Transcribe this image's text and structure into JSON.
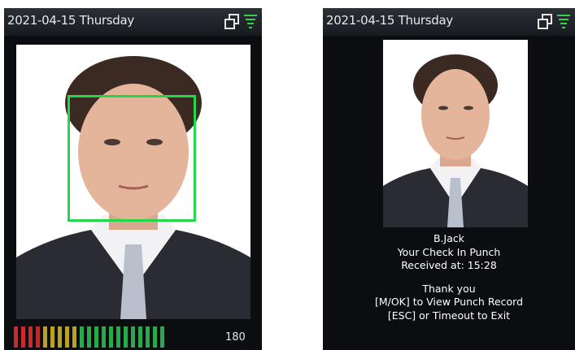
{
  "left_screen": {
    "status": {
      "date_text": "2021-04-15 Thursday",
      "icons": [
        "multi-window-icon",
        "wifi-icon"
      ]
    },
    "face_quality": {
      "value_text": "180",
      "segments": [
        "#cc2a2a",
        "#cc2a2a",
        "#cc2a2a",
        "#b32d2d",
        "#b8a21f",
        "#b8a21f",
        "#b8a21f",
        "#b8a21f",
        "#b8a21f",
        "#2aa84a",
        "#2aa84a",
        "#2aa84a",
        "#2aa84a",
        "#2aa84a",
        "#2aa84a",
        "#2aa84a",
        "#2aa84a",
        "#2aa84a",
        "#2aa84a",
        "#2aa84a",
        "#2aa84a"
      ]
    }
  },
  "right_screen": {
    "status": {
      "date_text": "2021-04-15 Thursday",
      "icons": [
        "multi-window-icon",
        "wifi-icon"
      ]
    },
    "message": {
      "name": "B.Jack",
      "line1": "Your Check In Punch",
      "line2": "Received at: 15:28",
      "line3": "Thank you",
      "line4": "[M/OK] to View Punch Record",
      "line5": "[ESC] or Timeout to Exit"
    }
  },
  "colors": {
    "face_frame": "#22d84a",
    "background": "#0b0d10"
  }
}
